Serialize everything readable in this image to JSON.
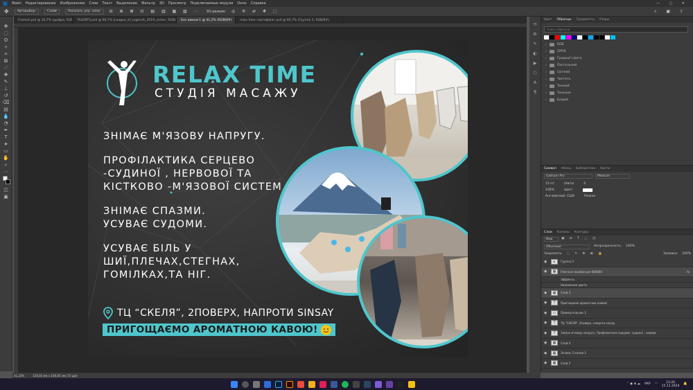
{
  "menu": {
    "app_icon": "Ps",
    "items": [
      "Файл",
      "Редактирование",
      "Изображение",
      "Слои",
      "Текст",
      "Выделение",
      "Фильтр",
      "3D",
      "Просмотр",
      "Подключаемые модули",
      "Окно",
      "Справка"
    ]
  },
  "options": {
    "auto_select": "Автовыбор:",
    "layer_mode": "Слой",
    "show_controls": "Показать упр. элем.",
    "mode_3d": "3D-режим:"
  },
  "tabs": [
    "Frame2.psd @ 16,7% (цифри, RGB/8)",
    "TALENTS.psd @ 66,7% (League_of_Legends_2019_vector, RGB/8)",
    "Без имени-1 @ 41,2% (RGB/8#)",
    "relax time сертифікат.psd @ 66,7% (Группа 3, RGB/8#)"
  ],
  "tools": [
    "move",
    "marquee",
    "lasso",
    "magic-wand",
    "crop",
    "eyedropper",
    "heal",
    "brush",
    "stamp",
    "history",
    "eraser",
    "gradient",
    "blur",
    "dodge",
    "pen",
    "type",
    "path-select",
    "shape",
    "hand",
    "zoom",
    "more",
    "colors"
  ],
  "status": {
    "zoom": "41,23%",
    "size": "120,02 мм x 100,05 мм (72 ppi)"
  },
  "panels": {
    "top_tabs": [
      "Цвет",
      "Образцы",
      "Градиенты",
      "Узоры"
    ],
    "search_placeholder": "Поиск образцов",
    "swatch_colors": [
      "#ffffff",
      "#000000",
      "#ff0000",
      "#00ffff",
      "#ff00ff",
      "#000080",
      "#ffffff",
      "#000000",
      "#00aaff",
      "#000000",
      "#000000",
      "#ffffff",
      "#00c0ff"
    ],
    "groups": [
      "RGB",
      "CMYK",
      "Градації сірого",
      "Пастельний",
      "Світлий",
      "Чистота",
      "Темний",
      "Темніше",
      "Блідий"
    ],
    "char_tabs": [
      "Символ",
      "Абзац",
      "Библиотеки",
      "Кисти"
    ],
    "font": "Gotham Pro",
    "font_style": "Medium",
    "font_size": "15 пт",
    "leading": "(Авто)",
    "tracking": "0",
    "scale": "100%",
    "color_label": "Цвет:",
    "lang": "Английский: США",
    "aa": "Резкое",
    "layer_tabs": [
      "Слои",
      "Каналы",
      "Контуры"
    ],
    "layer_kind": "Вид",
    "blend": "Обычные",
    "opacity_label": "Непрозрачность:",
    "opacity": "100%",
    "lock_label": "Закрепить:",
    "fill_label": "Заливка:",
    "fill": "100%",
    "layers": [
      {
        "name": "Группа 3",
        "kind": "group"
      },
      {
        "name": "Free-icon-location-pin-460600",
        "kind": "image",
        "fx": "fx"
      },
      {
        "name": "Эффекты",
        "kind": "effect"
      },
      {
        "name": "Наложение цвета",
        "kind": "effect"
      },
      {
        "name": "Слой 3",
        "kind": "image"
      },
      {
        "name": "Пригощаємо ароматною кавою!",
        "kind": "text"
      },
      {
        "name": "Прямоугольник 1",
        "kind": "shape"
      },
      {
        "name": "ТЦ \"СКЕЛЯ\", 2поверх, напроти sinsay",
        "kind": "text"
      },
      {
        "name": "Знімає м'язову напругу.  Профілактика серцево -судиної , нервов",
        "kind": "text"
      },
      {
        "name": "Слой 4",
        "kind": "image"
      },
      {
        "name": "Эллипс 2 копия 3",
        "kind": "image"
      },
      {
        "name": "Слой 2",
        "kind": "image"
      }
    ]
  },
  "taskbar": {
    "lang": "УКР",
    "time": "13:26",
    "date": "15.11.2024"
  },
  "art": {
    "brand": "RELAX TIME",
    "subtitle": "СТУДІЯ МАСАЖУ",
    "p1": "ЗНІМАЄ М'ЯЗОВУ НАПРУГУ.",
    "p2": "ПРОФІЛАКТИКА СЕРЦЕВО\n-СУДИНОЇ , НЕРВОВОЇ ТА\nКІСТКОВО -М'ЯЗОВОЇ СИСТЕМ.",
    "p3": "ЗНІМАЄ СПАЗМИ.\nУСУВАЄ СУДОМИ.",
    "p4": "УСУВАЄ БІЛЬ У\nШИЇ,ПЛЕЧАХ,СТЕГНАХ,\nГОМІЛКАХ,ТА НІГ.",
    "address": "ТЦ “СКЕЛЯ”, 2ПОВЕРХ, НАПРОТИ SINSAY",
    "coffee": "ПРИГОЩАЄМО АРОМАТНОЮ КАВОЮ!",
    "accent": "#4fc6cc"
  }
}
